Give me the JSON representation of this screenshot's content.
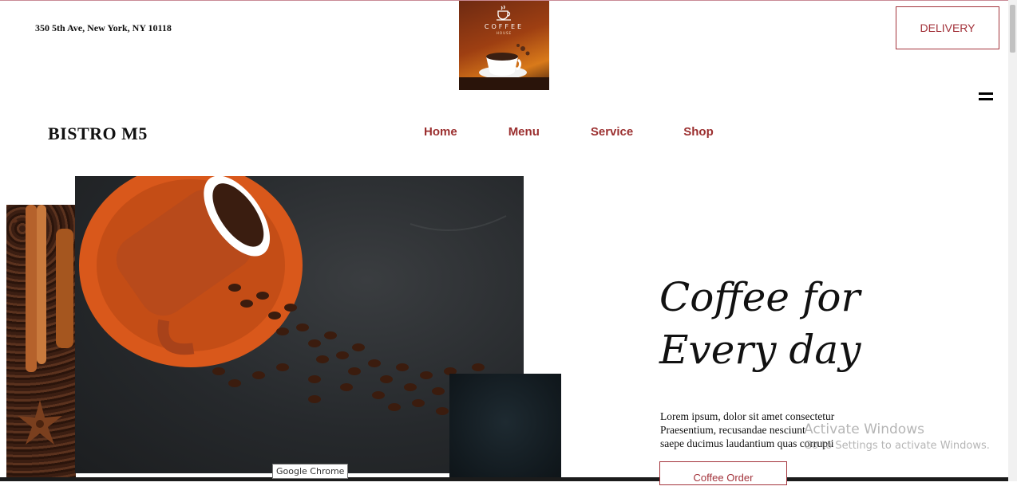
{
  "header": {
    "address": "350 5th Ave, New York, NY 10118",
    "logo": {
      "title": "COFFEE",
      "subtitle": "HOUSE"
    },
    "delivery_label": "DELIVERY"
  },
  "nav": {
    "brand": "BISTRO M5",
    "items": [
      {
        "label": "Home"
      },
      {
        "label": "Menu"
      },
      {
        "label": "Service"
      },
      {
        "label": "Shop"
      }
    ]
  },
  "hero": {
    "title_line1": "Coffee for",
    "title_line2": "Every day",
    "body_line1": "Lorem ipsum, dolor sit amet consectetur",
    "body_line2": "Praesentium, recusandae nesciunt",
    "body_line3": "saepe ducimus laudantium quas corrupti",
    "button_label": "Coffee Order"
  },
  "overlays": {
    "tooltip": "Google Chrome",
    "watermark_title": "Activate Windows",
    "watermark_sub": "Go to Settings to activate Windows."
  },
  "colors": {
    "accent": "#9b2f2f",
    "border": "#a3333b"
  }
}
